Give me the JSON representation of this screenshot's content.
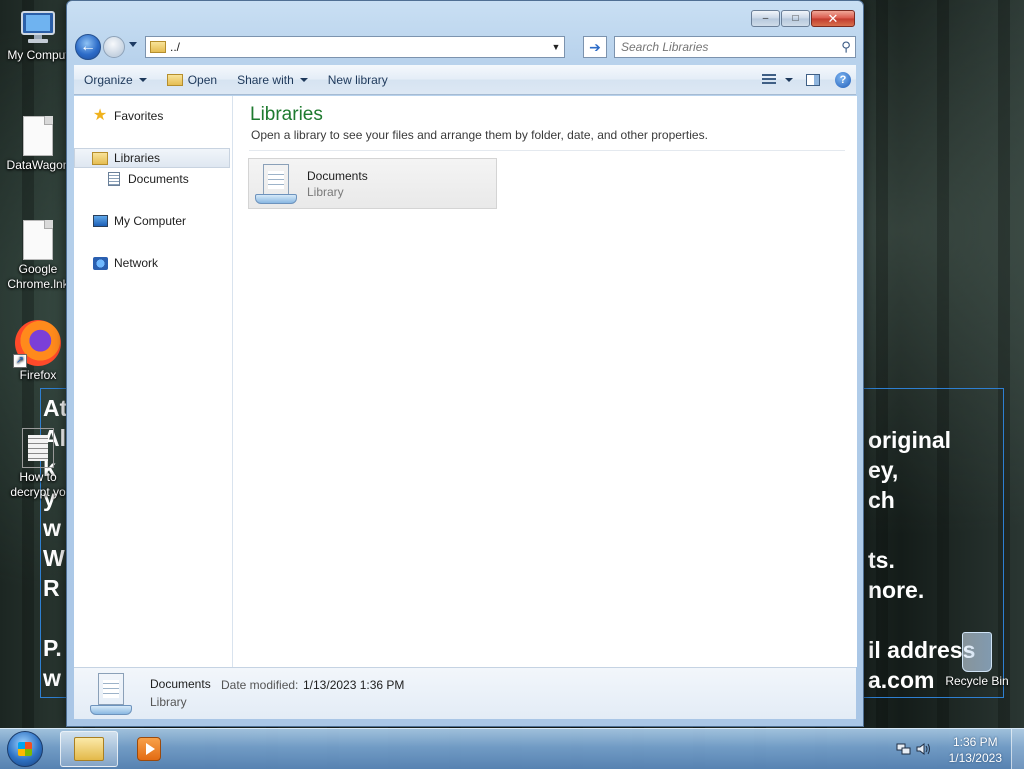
{
  "desktop": {
    "icons": [
      {
        "label": "My Comput",
        "icon": "computer-icon"
      },
      {
        "label": "DataWagon",
        "icon": "file-icon"
      },
      {
        "label": "Google Chrome.lnk",
        "icon": "file-icon"
      },
      {
        "label": "Firefox",
        "icon": "firefox-icon"
      },
      {
        "label": "How to decrypt yo",
        "icon": "text-file-icon"
      }
    ],
    "recycle_bin": {
      "label": "Recycle Bin",
      "icon": "recycle-bin-icon"
    },
    "ransom_left_lines": [
      "At",
      "Al",
      "k",
      "y",
      "w",
      "W",
      "R",
      "",
      "P.",
      "w"
    ],
    "ransom_right_lines": [
      "original",
      "ey,",
      "ch",
      "",
      "ts.",
      "nore.",
      "",
      "il address",
      "a.com"
    ]
  },
  "window": {
    "caption_buttons": {
      "minimize": "–",
      "maximize": "□",
      "close": "✕"
    },
    "address": {
      "value": "../",
      "icon": "libraries-folder-icon"
    },
    "go_symbol": "➔",
    "search": {
      "placeholder": "Search Libraries",
      "icon": "search-icon"
    },
    "toolbar": {
      "organize": "Organize",
      "open": "Open",
      "share_with": "Share with",
      "new_library": "New library"
    },
    "nav_pane": {
      "favorites": "Favorites",
      "libraries": "Libraries",
      "documents": "Documents",
      "my_computer": "My Computer",
      "network": "Network"
    },
    "content": {
      "title": "Libraries",
      "subtitle": "Open a library to see your files and arrange them by folder, date, and other properties.",
      "items": [
        {
          "name": "Documents",
          "type": "Library"
        }
      ]
    },
    "details": {
      "name": "Documents",
      "modified_label": "Date modified:",
      "modified_value": "1/13/2023 1:36 PM",
      "type": "Library"
    }
  },
  "taskbar": {
    "time": "1:36 PM",
    "date": "1/13/2023",
    "items": [
      "file-explorer-icon",
      "media-player-icon"
    ]
  }
}
